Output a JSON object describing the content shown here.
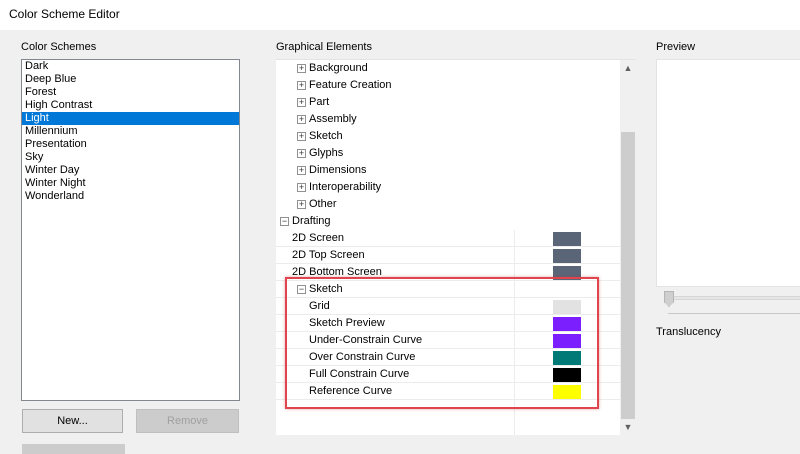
{
  "window": {
    "title": "Color Scheme Editor"
  },
  "schemes": {
    "label": "Color Schemes",
    "items": [
      "Dark",
      "Deep Blue",
      "Forest",
      "High Contrast",
      "Light",
      "Millennium",
      "Presentation",
      "Sky",
      "Winter Day",
      "Winter Night",
      "Wonderland"
    ],
    "selected": "Light"
  },
  "buttons": {
    "new": "New...",
    "remove": "Remove"
  },
  "graphical": {
    "label": "Graphical Elements",
    "rows": [
      {
        "label": "Background",
        "expander": "+"
      },
      {
        "label": "Feature Creation",
        "expander": "+"
      },
      {
        "label": "Part",
        "expander": "+"
      },
      {
        "label": "Assembly",
        "expander": "+"
      },
      {
        "label": "Sketch",
        "expander": "+"
      },
      {
        "label": "Glyphs",
        "expander": "+"
      },
      {
        "label": "Dimensions",
        "expander": "+"
      },
      {
        "label": "Interoperability",
        "expander": "+"
      },
      {
        "label": "Other",
        "expander": "+"
      },
      {
        "label": "Drafting",
        "expander": "−"
      },
      {
        "label": "2D Screen",
        "color": "#5a6678"
      },
      {
        "label": "2D Top Screen",
        "color": "#5a6678"
      },
      {
        "label": "2D Bottom Screen",
        "color": "#5a6678"
      },
      {
        "label": "Sketch",
        "expander": "−"
      },
      {
        "label": "Grid",
        "color": "#e2e2e2"
      },
      {
        "label": "Sketch Preview",
        "color": "#7b1fff"
      },
      {
        "label": "Under-Constrain Curve",
        "color": "#7b1fff"
      },
      {
        "label": "Over Constrain Curve",
        "color": "#007a76"
      },
      {
        "label": "Full Constrain Curve",
        "color": "#000000"
      },
      {
        "label": "Reference Curve",
        "color": "#ffff00"
      }
    ]
  },
  "preview": {
    "label": "Preview",
    "translucency_label": "Translucency",
    "translucency_value": 0
  },
  "icons": {
    "scroll_up": "▲",
    "scroll_down": "▼"
  },
  "accent_color": "#0078d7",
  "highlight_color": "#e0454d"
}
